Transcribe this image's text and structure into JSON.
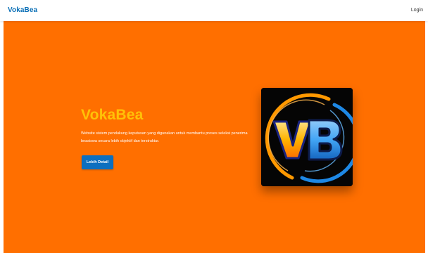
{
  "navbar": {
    "brand": "VokaBea",
    "login_label": "Login"
  },
  "hero": {
    "title": "VokaBea",
    "description": "Website sistem pendukung keputusan yang digunakan untuk membantu proses seleksi penerima beasiswa secara lebih objektif dan terstruktur.",
    "button_label": "Lebih Detail",
    "logo_text": "VB"
  },
  "colors": {
    "brand": "#0a6fb6",
    "hero_background": "#ff6f00",
    "title": "#ffc107",
    "button": "#0d6fbf",
    "logo_ring_orange": "#ff9800",
    "logo_ring_blue": "#1e88e5"
  }
}
